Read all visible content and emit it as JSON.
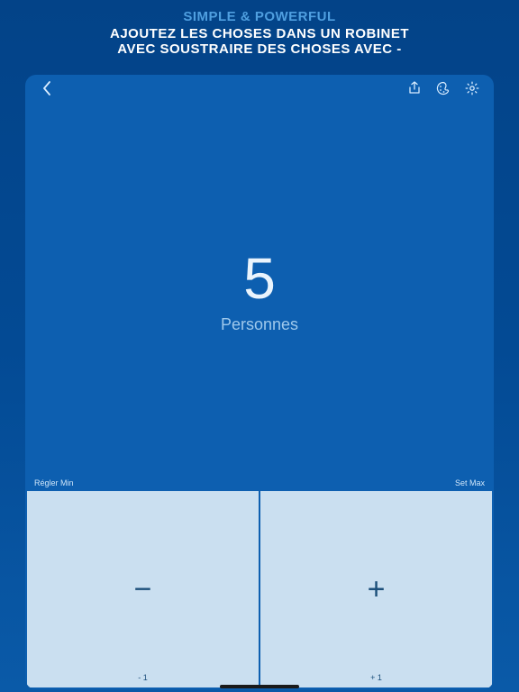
{
  "promo": {
    "line1": "SIMPLE & POWERFUL",
    "line2": "AJOUTEZ LES CHOSES DANS UN ROBINET",
    "line3": "AVEC SOUSTRAIRE DES CHOSES AVEC -"
  },
  "counter": {
    "value": "5",
    "label": "Personnes"
  },
  "limits": {
    "min_label": "Régler Min",
    "max_label": "Set Max"
  },
  "pads": {
    "minus_sign": "−",
    "minus_delta": "- 1",
    "plus_sign": "+",
    "plus_delta": "+ 1"
  }
}
